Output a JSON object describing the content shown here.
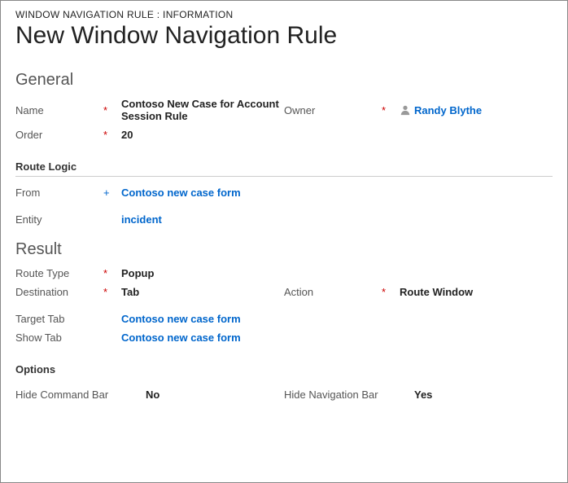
{
  "breadcrumb": "WINDOW NAVIGATION RULE : INFORMATION",
  "title": "New Window Navigation Rule",
  "sections": {
    "general": {
      "title": "General",
      "name_label": "Name",
      "name_value": "Contoso New Case for Account Session Rule",
      "owner_label": "Owner",
      "owner_value": "Randy Blythe",
      "order_label": "Order",
      "order_value": "20",
      "route_logic_title": "Route Logic",
      "from_label": "From",
      "from_value": "Contoso new case form",
      "entity_label": "Entity",
      "entity_value": "incident"
    },
    "result": {
      "title": "Result",
      "route_type_label": "Route Type",
      "route_type_value": "Popup",
      "destination_label": "Destination",
      "destination_value": "Tab",
      "action_label": "Action",
      "action_value": "Route Window",
      "target_tab_label": "Target Tab",
      "target_tab_value": "Contoso new case form",
      "show_tab_label": "Show Tab",
      "show_tab_value": "Contoso new case form",
      "options_title": "Options",
      "hide_cmd_label": "Hide Command Bar",
      "hide_cmd_value": "No",
      "hide_nav_label": "Hide Navigation Bar",
      "hide_nav_value": "Yes"
    }
  },
  "markers": {
    "required": "*",
    "recommended": "+"
  }
}
